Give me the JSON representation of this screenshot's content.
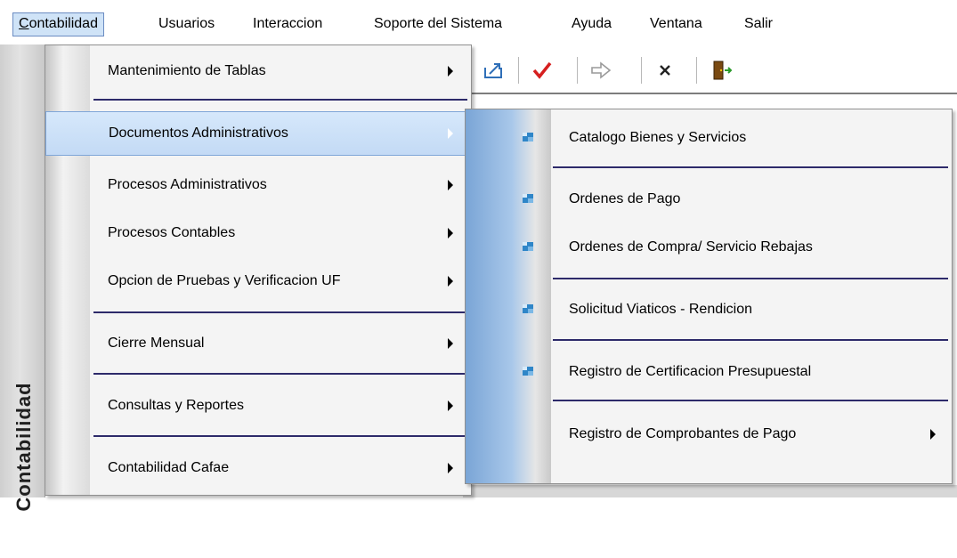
{
  "menubar": {
    "items": [
      {
        "label": "Contabilidad"
      },
      {
        "label": "Usuarios"
      },
      {
        "label": "Interaccion"
      },
      {
        "label": "Soporte del Sistema"
      },
      {
        "label": "Ayuda"
      },
      {
        "label": "Ventana"
      },
      {
        "label": "Salir"
      }
    ]
  },
  "sidebar": {
    "title": "Contabilidad"
  },
  "toolbar": {
    "icons": [
      "export-icon",
      "check-icon",
      "forward-arrow-icon",
      "close-x-icon",
      "exit-door-icon"
    ]
  },
  "menu": {
    "items": [
      {
        "label": "Mantenimiento de Tablas",
        "submenu": true
      },
      {
        "label": "Documentos Administrativos",
        "submenu": true,
        "highlighted": true
      },
      {
        "label": "Procesos Administrativos",
        "submenu": true
      },
      {
        "label": "Procesos Contables",
        "submenu": true
      },
      {
        "label": "Opcion de Pruebas y Verificacion UF",
        "submenu": true
      },
      {
        "label": "Cierre Mensual",
        "submenu": true
      },
      {
        "label": "Consultas y Reportes",
        "submenu": true
      },
      {
        "label": "Contabilidad Cafae",
        "submenu": true
      }
    ]
  },
  "submenu": {
    "items": [
      {
        "label": "Catalogo Bienes y Servicios"
      },
      {
        "label": "Ordenes de Pago"
      },
      {
        "label": "Ordenes de Compra/ Servicio Rebajas"
      },
      {
        "label": "Solicitud Viaticos - Rendicion"
      },
      {
        "label": "Registro de Certificacion Presupuestal"
      },
      {
        "label": "Registro de Comprobantes de Pago",
        "submenu": true
      }
    ]
  },
  "colors": {
    "highlight": "#cfe3f7",
    "separator": "#2d2a6a",
    "gutter_blue": "#a9c8ea",
    "icon_blue": "#2f86c8"
  }
}
